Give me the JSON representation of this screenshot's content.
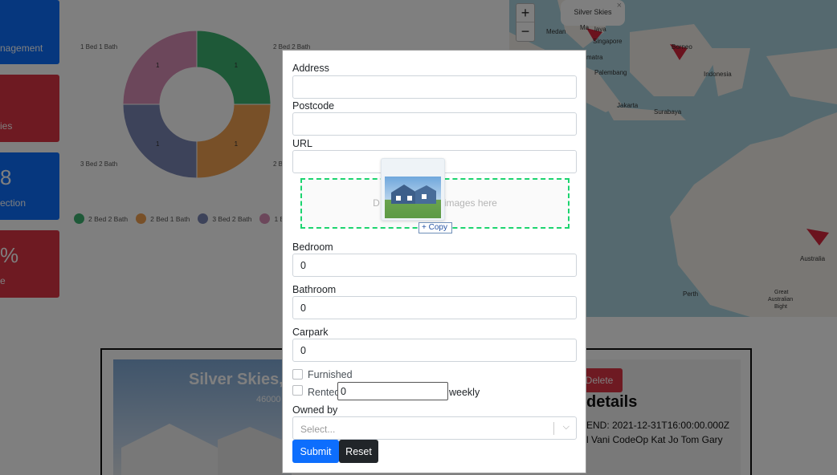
{
  "background": {
    "tiles": [
      {
        "big": "",
        "small": "nagement",
        "color": "#0d6efd"
      },
      {
        "big": "",
        "small": "ies",
        "color": "#dc3545"
      },
      {
        "big": "8",
        "small": "ection",
        "color": "#0d6efd"
      },
      {
        "big": "%",
        "small": "e",
        "color": "#dc3545"
      }
    ],
    "chart_data": {
      "type": "pie",
      "categories": [
        "2 Bed 2 Bath",
        "2 Bed 1 Bath",
        "3 Bed 2 Bath",
        "1 Bed 1 Bath"
      ],
      "values": [
        1,
        1,
        1,
        1
      ],
      "colors": [
        "#3cb371",
        "#f0a050",
        "#7b86b5",
        "#d98fb6"
      ],
      "legend_position": "bottom",
      "outer_labels": [
        "1 Bed 1 Bath",
        "2 Bed 2 Bath",
        "3 Bed 2 Bath",
        "2 B"
      ],
      "slice_labels": [
        "1",
        "1",
        "1",
        "1"
      ],
      "legend": [
        "2 Bed 2 Bath",
        "2 Bed 1 Bath",
        "3 Bed 2 Bath",
        "1 B"
      ]
    },
    "map": {
      "zoom_in": "+",
      "zoom_out": "−",
      "popup_title": "Silver Skies",
      "popup_close": "×",
      "places": [
        "Medan",
        "Ma",
        "laya",
        "Singapore",
        "matra",
        "Palembang",
        "Borneo",
        "Indonesia",
        "Jakarta",
        "Surabaya",
        "Australia",
        "Perth",
        "Great",
        "Australian",
        "Bight"
      ]
    },
    "detail": {
      "title": "Silver Skies,",
      "subtitle": "46000",
      "delete_label": "Delete",
      "heading": "details",
      "line1": "END: 2021-12-31T16:00:00.000Z",
      "line2": "l Vani CodeOp Kat Jo Tom Gary"
    }
  },
  "form": {
    "address_label": "Address",
    "address_value": "",
    "postcode_label": "Postcode",
    "postcode_value": "",
    "url_label": "URL",
    "url_value": "",
    "dropzone_text": "D                        images here",
    "drag_copy_label": "+ Copy",
    "bedroom_label": "Bedroom",
    "bedroom_value": "0",
    "bathroom_label": "Bathroom",
    "bathroom_value": "0",
    "carpark_label": "Carpark",
    "carpark_value": "0",
    "furnished_label": "Furnished",
    "rented_label": "Rented",
    "rent_value": "0",
    "rent_unit": "weekly",
    "owned_by_label": "Owned by",
    "owned_by_placeholder": "Select...",
    "submit_label": "Submit",
    "reset_label": "Reset"
  }
}
